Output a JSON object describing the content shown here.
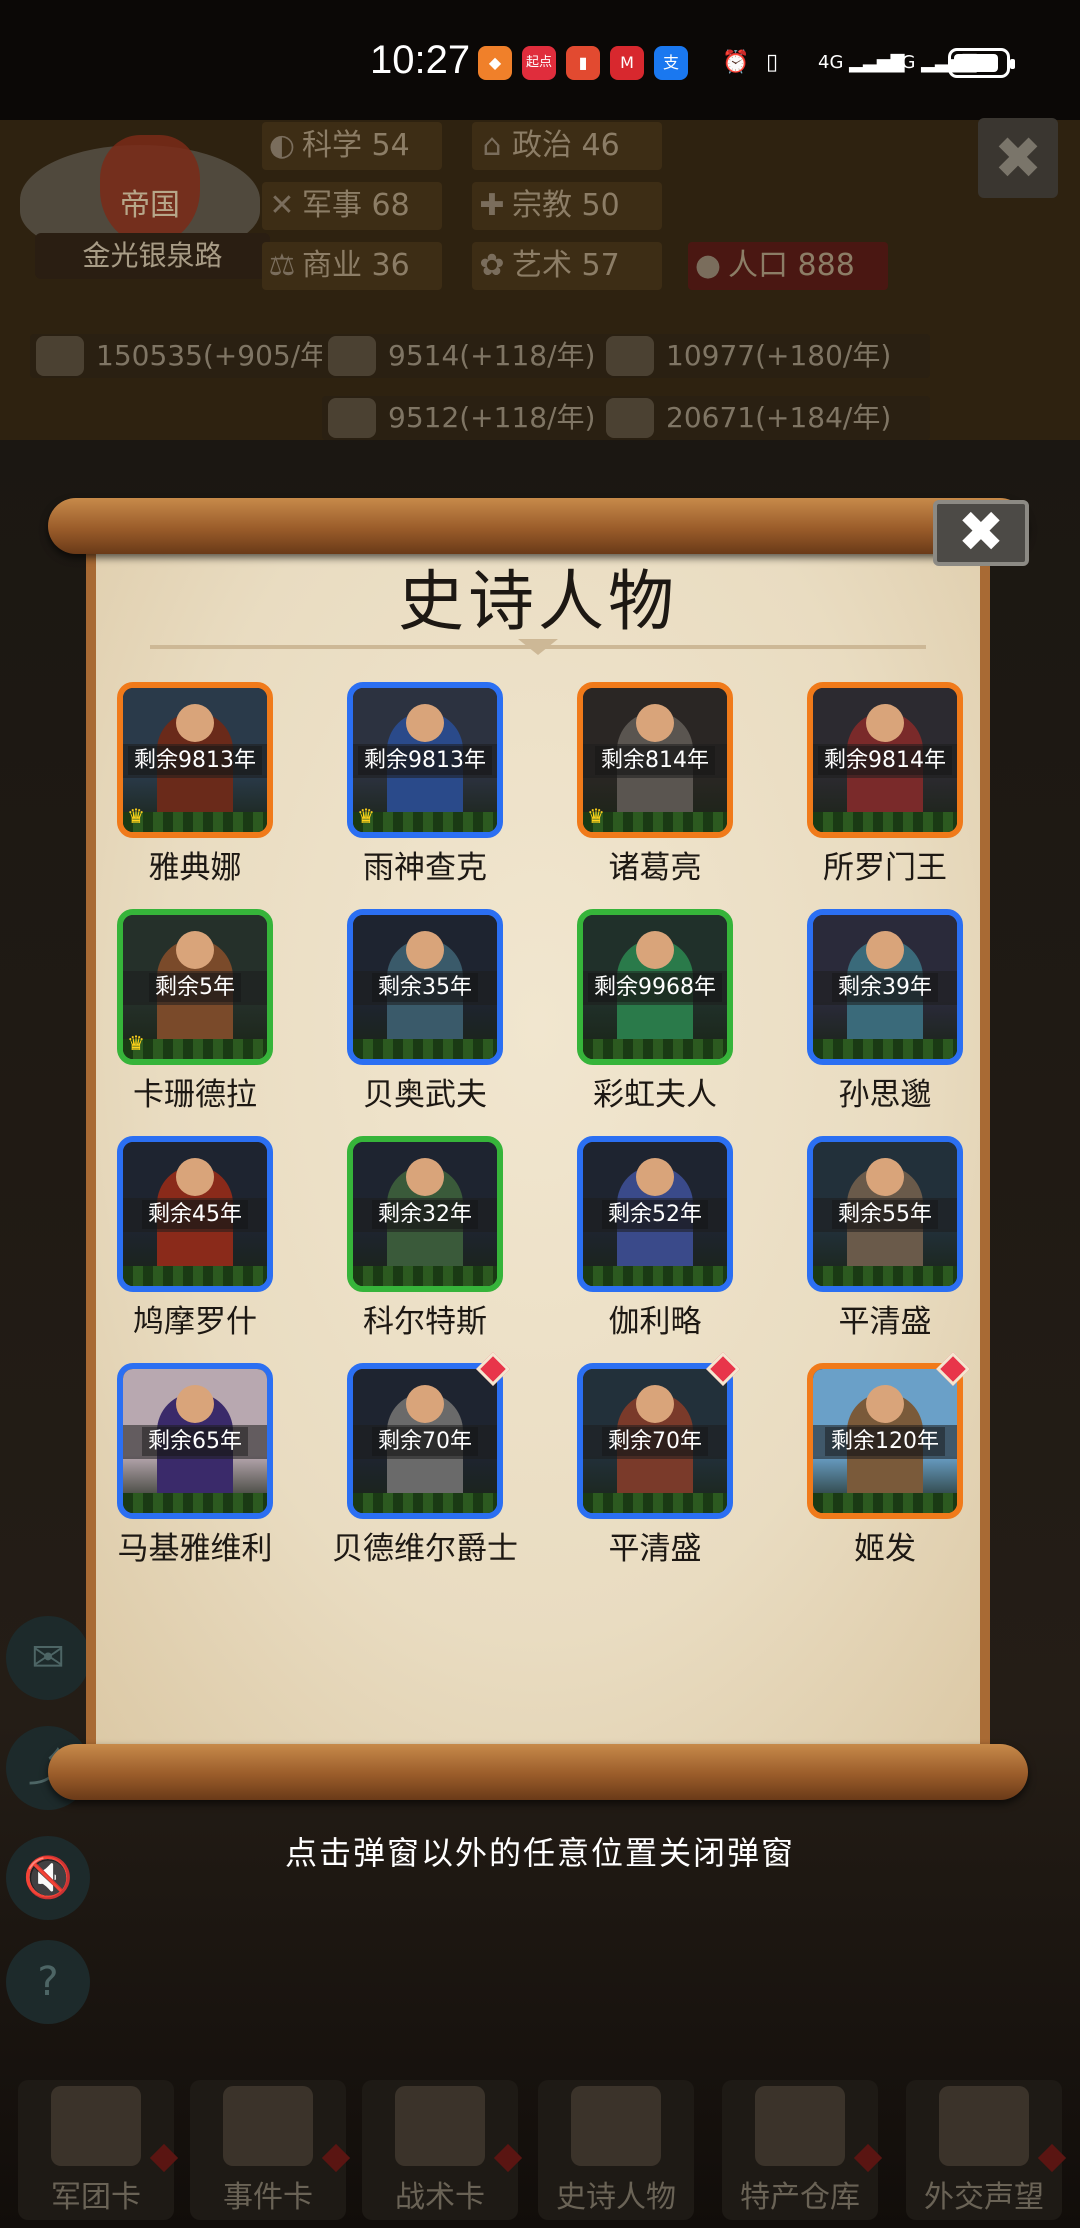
{
  "status_bar": {
    "time": "10:27",
    "notification_icons": [
      "app-icon-orange",
      "qidian-icon",
      "app-icon-red",
      "china-merchants-icon",
      "alipay-icon"
    ],
    "notification_labels": [
      "◆",
      "起点",
      "▮",
      "M",
      "支"
    ],
    "system_icons": [
      "alarm-icon",
      "vibrate-icon",
      "signal-4g-icon",
      "signal-4g-icon",
      "battery-charging-icon"
    ],
    "signal_label_1": "4G",
    "signal_label_2": "4G"
  },
  "empire": {
    "badge_title": "帝国",
    "name": "金光银泉路"
  },
  "stats": [
    {
      "label": "科学",
      "value": "54"
    },
    {
      "label": "政治",
      "value": "46"
    },
    {
      "label": "军事",
      "value": "68"
    },
    {
      "label": "宗教",
      "value": "50"
    },
    {
      "label": "商业",
      "value": "36"
    },
    {
      "label": "艺术",
      "value": "57"
    },
    {
      "label": "人口",
      "value": "888"
    }
  ],
  "resources": [
    {
      "icon": "gold-icon",
      "value": "150535(+905/年)"
    },
    {
      "icon": "iron-icon",
      "value": "9514(+118/年)"
    },
    {
      "icon": "weapon-icon",
      "value": "10977(+180/年)"
    },
    {
      "icon": "stone-icon",
      "value": "9512(+118/年)"
    },
    {
      "icon": "meat-icon",
      "value": "20671(+184/年)"
    }
  ],
  "modal": {
    "title": "史诗人物",
    "close_symbol": "✖",
    "hint": "点击弹窗以外的任意位置关闭弹窗"
  },
  "characters": [
    {
      "name": "雅典娜",
      "remain": "剩余9813年",
      "rarity": "orange",
      "crowned": true,
      "new": false
    },
    {
      "name": "雨神查克",
      "remain": "剩余9813年",
      "rarity": "blue",
      "crowned": true,
      "new": false
    },
    {
      "name": "诸葛亮",
      "remain": "剩余814年",
      "rarity": "orange",
      "crowned": true,
      "new": false
    },
    {
      "name": "所罗门王",
      "remain": "剩余9814年",
      "rarity": "orange",
      "crowned": false,
      "new": false
    },
    {
      "name": "卡珊德拉",
      "remain": "剩余5年",
      "rarity": "green",
      "crowned": true,
      "new": false
    },
    {
      "name": "贝奥武夫",
      "remain": "剩余35年",
      "rarity": "blue",
      "crowned": false,
      "new": false
    },
    {
      "name": "彩虹夫人",
      "remain": "剩余9968年",
      "rarity": "green",
      "crowned": false,
      "new": false
    },
    {
      "name": "孙思邈",
      "remain": "剩余39年",
      "rarity": "blue",
      "crowned": false,
      "new": false
    },
    {
      "name": "鸠摩罗什",
      "remain": "剩余45年",
      "rarity": "blue",
      "crowned": false,
      "new": false
    },
    {
      "name": "科尔特斯",
      "remain": "剩余32年",
      "rarity": "green",
      "crowned": false,
      "new": false
    },
    {
      "name": "伽利略",
      "remain": "剩余52年",
      "rarity": "blue",
      "crowned": false,
      "new": false
    },
    {
      "name": "平清盛",
      "remain": "剩余55年",
      "rarity": "blue",
      "crowned": false,
      "new": false
    },
    {
      "name": "马基雅维利",
      "remain": "剩余65年",
      "rarity": "blue",
      "crowned": false,
      "new": false
    },
    {
      "name": "贝德维尔爵士",
      "remain": "剩余70年",
      "rarity": "blue",
      "crowned": false,
      "new": true
    },
    {
      "name": "平清盛",
      "remain": "剩余70年",
      "rarity": "blue",
      "crowned": false,
      "new": true
    },
    {
      "name": "姬发",
      "remain": "剩余120年",
      "rarity": "orange",
      "crowned": false,
      "new": true
    }
  ],
  "bottom_tabs": [
    {
      "label": "军团卡"
    },
    {
      "label": "事件卡"
    },
    {
      "label": "战术卡"
    },
    {
      "label": "史诗人物"
    },
    {
      "label": "特产仓库"
    },
    {
      "label": "外交声望"
    }
  ],
  "colors": {
    "rarity_orange": "#f07a1a",
    "rarity_blue": "#2b6ff2",
    "rarity_green": "#36b43a",
    "new_badge": "#e8354a"
  }
}
